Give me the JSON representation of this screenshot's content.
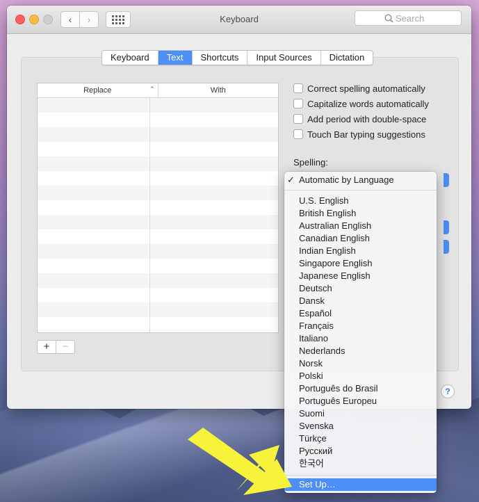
{
  "window": {
    "title": "Keyboard",
    "search_placeholder": "Search"
  },
  "tabs": [
    {
      "label": "Keyboard"
    },
    {
      "label": "Text"
    },
    {
      "label": "Shortcuts"
    },
    {
      "label": "Input Sources"
    },
    {
      "label": "Dictation"
    }
  ],
  "active_tab": "Text",
  "table": {
    "col_replace": "Replace",
    "col_with": "With"
  },
  "buttons": {
    "add": "+",
    "remove": "−",
    "help": "?"
  },
  "options": [
    {
      "label": "Correct spelling automatically",
      "checked": false
    },
    {
      "label": "Capitalize words automatically",
      "checked": false
    },
    {
      "label": "Add period with double-space",
      "checked": false
    },
    {
      "label": "Touch Bar typing suggestions",
      "checked": false
    }
  ],
  "spelling": {
    "label": "Spelling:",
    "selected": "Automatic by Language"
  },
  "menu": {
    "selected_item": "Automatic by Language",
    "languages": [
      "U.S. English",
      "British English",
      "Australian English",
      "Canadian English",
      "Indian English",
      "Singapore English",
      "Japanese English",
      "Deutsch",
      "Dansk",
      "Español",
      "Français",
      "Italiano",
      "Nederlands",
      "Norsk",
      "Polski",
      "Português do Brasil",
      "Português Europeu",
      "Suomi",
      "Svenska",
      "Türkçe",
      "Русский",
      "한국어"
    ],
    "setup": "Set Up…",
    "highlighted": "Set Up…"
  },
  "colors": {
    "accent": "#4c8ff6",
    "arrow": "#f6f33a"
  }
}
